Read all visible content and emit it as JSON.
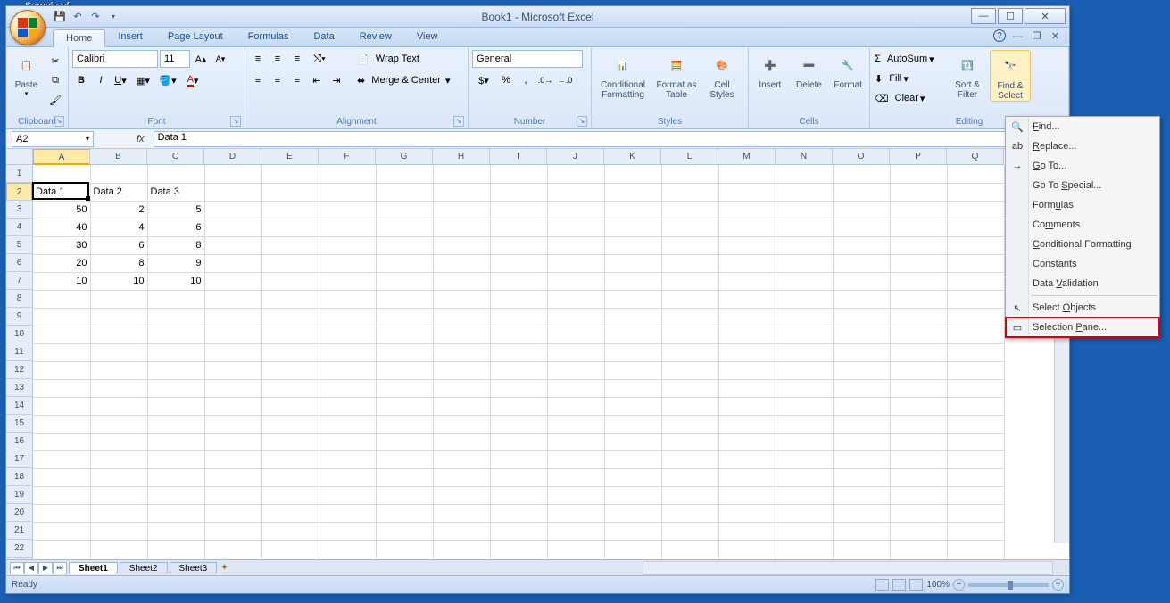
{
  "desktop": {
    "icon_label": "Sample of"
  },
  "title": "Book1 - Microsoft Excel",
  "tabs": [
    "Home",
    "Insert",
    "Page Layout",
    "Formulas",
    "Data",
    "Review",
    "View"
  ],
  "active_tab": 0,
  "ribbon": {
    "clipboard": {
      "label": "Clipboard",
      "paste": "Paste"
    },
    "font": {
      "label": "Font",
      "name": "Calibri",
      "size": "11"
    },
    "alignment": {
      "label": "Alignment",
      "wrap": "Wrap Text",
      "merge": "Merge & Center"
    },
    "number": {
      "label": "Number",
      "format": "General"
    },
    "styles": {
      "label": "Styles",
      "cond": "Conditional Formatting",
      "table": "Format as Table",
      "cell": "Cell Styles"
    },
    "cells": {
      "label": "Cells",
      "insert": "Insert",
      "delete": "Delete",
      "format": "Format"
    },
    "editing": {
      "label": "Editing",
      "autosum": "AutoSum",
      "fill": "Fill",
      "clear": "Clear",
      "sort": "Sort & Filter",
      "find": "Find & Select"
    }
  },
  "namebox": "A2",
  "formula": "Data 1",
  "columns": [
    "A",
    "B",
    "C",
    "D",
    "E",
    "F",
    "G",
    "H",
    "I",
    "J",
    "K",
    "L",
    "M",
    "N",
    "O",
    "P",
    "Q"
  ],
  "row_count": 23,
  "active": {
    "col": 0,
    "row": 1
  },
  "cells": {
    "A2": "Data 1",
    "B2": "Data 2",
    "C2": "Data 3",
    "A3": "50",
    "B3": "2",
    "C3": "5",
    "A4": "40",
    "B4": "4",
    "C4": "6",
    "A5": "30",
    "B5": "6",
    "C5": "8",
    "A6": "20",
    "B6": "8",
    "C6": "9",
    "A7": "10",
    "B7": "10",
    "C7": "10"
  },
  "sheets": [
    "Sheet1",
    "Sheet2",
    "Sheet3"
  ],
  "active_sheet": 0,
  "status": {
    "ready": "Ready",
    "zoom": "100%"
  },
  "menu": {
    "items": [
      {
        "label": "Find...",
        "icon": "🔍",
        "u": "F"
      },
      {
        "label": "Replace...",
        "icon": "ab",
        "u": "R"
      },
      {
        "label": "Go To...",
        "icon": "→",
        "u": "G"
      },
      {
        "label": "Go To Special...",
        "u": "S"
      },
      {
        "label": "Formulas",
        "u": "u"
      },
      {
        "label": "Comments",
        "u": "m"
      },
      {
        "label": "Conditional Formatting",
        "u": "C"
      },
      {
        "label": "Constants",
        "u": "N"
      },
      {
        "label": "Data Validation",
        "u": "V"
      },
      {
        "sep": true
      },
      {
        "label": "Select Objects",
        "icon": "↖",
        "u": "O"
      },
      {
        "label": "Selection Pane...",
        "icon": "▭",
        "u": "P",
        "highlighted": true
      }
    ]
  }
}
